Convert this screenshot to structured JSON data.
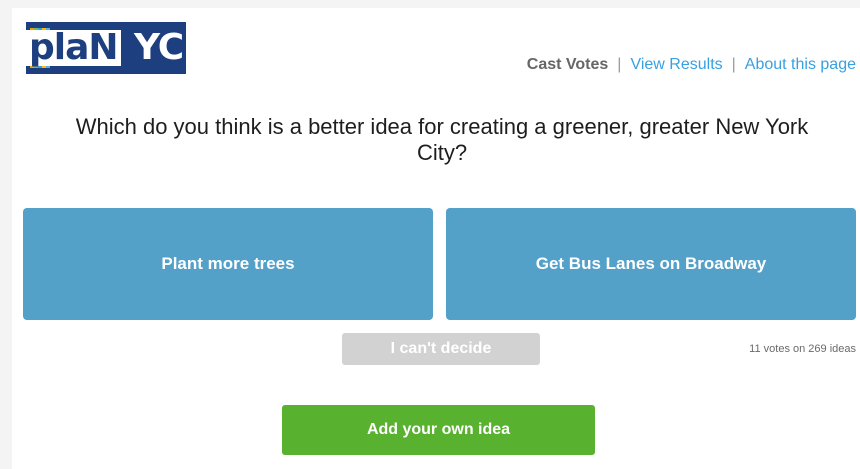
{
  "logo": {
    "text_plan": "plaN",
    "text_nyc": "YC",
    "stripe_colors": [
      "#f0a000",
      "#7ab850",
      "#3aa0d8",
      "#f2c000",
      "#5cb0e0",
      "#1d3f7f"
    ]
  },
  "nav": {
    "cast_votes": "Cast Votes",
    "separator": "|",
    "view_results": "View Results",
    "about": "About this page"
  },
  "question": "Which do you think is a better idea for creating a greener, greater New York City?",
  "choices": {
    "left": "Plant more trees",
    "right": "Get Bus Lanes on Broadway"
  },
  "cant_decide": "I can't decide",
  "vote_count": "11 votes on 269 ideas",
  "add_idea": "Add your own idea",
  "colors": {
    "choice": "#53a0c9",
    "cant_decide": "#d2d2d2",
    "add_idea": "#58b22f",
    "link": "#39a0e0",
    "logo": "#1d3f7f"
  }
}
